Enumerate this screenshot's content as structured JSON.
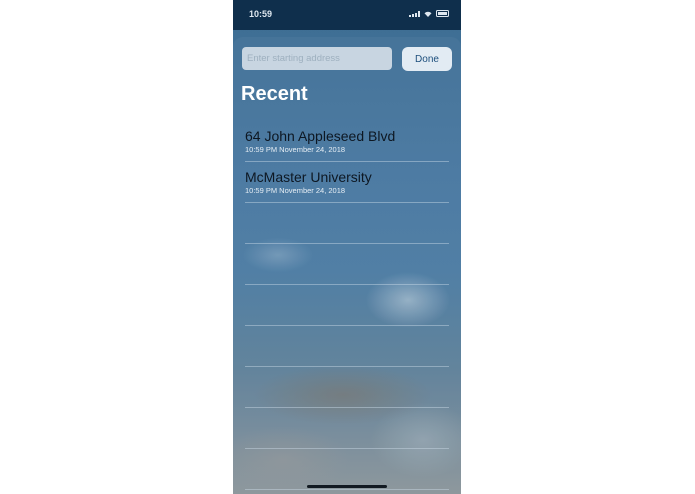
{
  "status_bar": {
    "time": "10:59"
  },
  "search": {
    "placeholder": "Enter starting address",
    "value": ""
  },
  "done_button": {
    "label": "Done"
  },
  "section": {
    "title": "Recent"
  },
  "recent_items": [
    {
      "title": "64 John Appleseed Blvd",
      "subtitle": "10:59 PM November 24, 2018"
    },
    {
      "title": "McMaster University",
      "subtitle": "10:59 PM November 24, 2018"
    },
    {
      "title": "",
      "subtitle": ""
    },
    {
      "title": "",
      "subtitle": ""
    },
    {
      "title": "",
      "subtitle": ""
    },
    {
      "title": "",
      "subtitle": ""
    },
    {
      "title": "",
      "subtitle": ""
    },
    {
      "title": "",
      "subtitle": ""
    },
    {
      "title": "",
      "subtitle": ""
    }
  ],
  "icons": {
    "signal": "signal-icon",
    "wifi": "wifi-icon",
    "battery": "battery-icon"
  },
  "colors": {
    "status_bar": "#0f2f4c",
    "accent": "#1c4e7c",
    "title_text": "#ffffff"
  }
}
